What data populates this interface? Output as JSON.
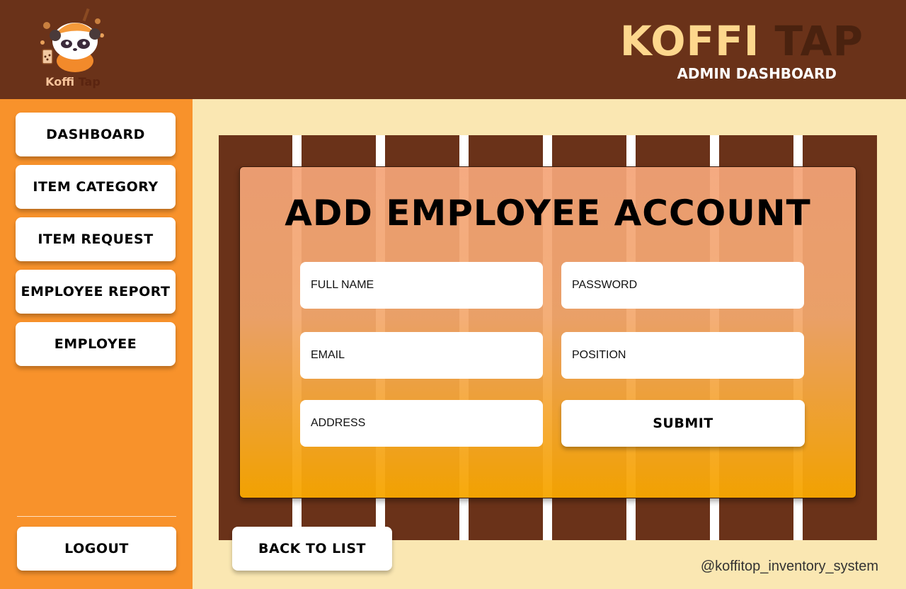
{
  "header": {
    "logo": {
      "word1": "Koffi",
      "word2": "Tap",
      "icon": "panda-mascot-logo"
    },
    "brand_word1": "KOFFI",
    "brand_word2": "TAP",
    "subtitle": "ADMIN DASHBOARD",
    "colors": {
      "bar": "#6A3219",
      "brand_light": "#FDD78D",
      "brand_dark": "#4A220F"
    }
  },
  "sidebar": {
    "items": [
      {
        "label": "DASHBOARD"
      },
      {
        "label": "ITEM CATEGORY"
      },
      {
        "label": "ITEM REQUEST"
      },
      {
        "label": "EMPLOYEE REPORT"
      },
      {
        "label": "EMPLOYEE"
      }
    ],
    "logout_label": "LOGOUT",
    "color": "#F8922B"
  },
  "form": {
    "title": "ADD EMPLOYEE ACCOUNT",
    "full_name_placeholder": "FULL NAME",
    "password_placeholder": "PASSWORD",
    "email_placeholder": "EMAIL",
    "position_placeholder": "POSITION",
    "address_placeholder": "ADDRESS",
    "submit_label": "SUBMIT"
  },
  "back_label": "BACK TO LIST",
  "footer": {
    "handle": "@koffitop_inventory_system"
  },
  "page_background": "#FAE7B2"
}
